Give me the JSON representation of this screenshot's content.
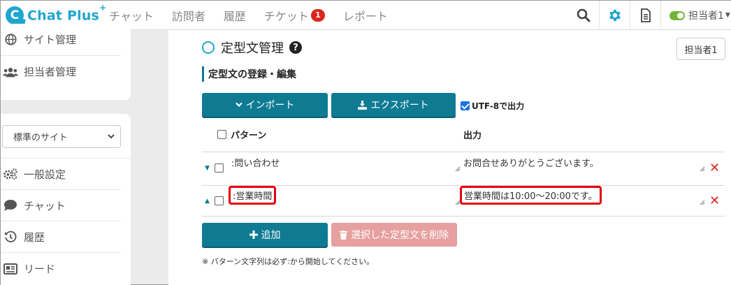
{
  "brand": {
    "name": "Chat Plus",
    "sup": "+"
  },
  "nav": {
    "items": [
      "チャット",
      "訪問者",
      "履歴",
      "チケット",
      "レポート"
    ],
    "ticket_badge": "1",
    "user": "担当者1"
  },
  "sidebar": {
    "top_items": [
      {
        "icon": "globe-icon",
        "label": "サイト管理"
      },
      {
        "icon": "users-icon",
        "label": "担当者管理"
      }
    ],
    "site_select": "標準のサイト",
    "items": [
      {
        "icon": "gears-icon",
        "label": "一般設定"
      },
      {
        "icon": "chat-bubble-icon",
        "label": "チャット"
      },
      {
        "icon": "history-icon",
        "label": "履歴"
      },
      {
        "icon": "id-card-icon",
        "label": "リード"
      }
    ]
  },
  "main": {
    "title": "定型文管理",
    "help": "?",
    "user_button": "担当者1",
    "section": "定型文の登録・編集",
    "import_label": "インポート",
    "export_label": "エクスポート",
    "utf8_label": "UTF-8で出力",
    "utf8_checked": true,
    "col_pattern": "パターン",
    "col_output": "出力",
    "rows": [
      {
        "pattern": ":問い合わせ",
        "output": "お問合せありがとうございます。",
        "arrow": "down"
      },
      {
        "pattern": ":営業時間",
        "output": "営業時間は10:00～20:00です。",
        "arrow": "up"
      }
    ],
    "add_label": "追加",
    "delete_label": "選択した定型文を削除",
    "note": "※ パターン文字列は必ず:から開始してください。"
  },
  "colors": {
    "accent": "#0f7b93",
    "brand": "#1fa6cf",
    "danger": "#d9261c",
    "highlight": "#e3000f"
  }
}
